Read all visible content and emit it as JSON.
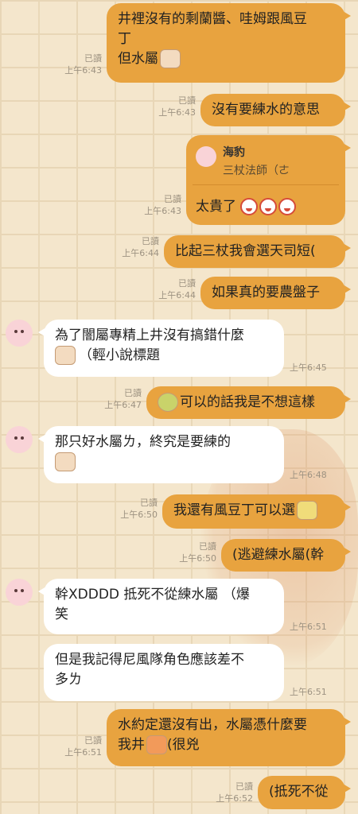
{
  "messages": [
    {
      "id": "m1",
      "text_line1": "井裡沒有的剩蘭醬、哇姆跟風豆",
      "text_line2": "丁",
      "text_line3": "但水屬",
      "read": "已讀",
      "time": "上午6:43"
    },
    {
      "id": "m2",
      "text": "沒有要練水的意思",
      "read": "已讀",
      "time": "上午6:43"
    },
    {
      "id": "m3",
      "reply_name": "海豹",
      "reply_text": "三杖法師（ㄜ",
      "text": "太貴了",
      "read": "已讀",
      "time": "上午6:43"
    },
    {
      "id": "m4",
      "text": "比起三杖我會選天司短(",
      "read": "已讀",
      "time": "上午6:44"
    },
    {
      "id": "m5",
      "text": "如果真的要農盤子",
      "read": "已讀",
      "time": "上午6:44"
    },
    {
      "id": "m6",
      "text_line1": "為了闇屬專精上井沒有搞錯什麼",
      "text_line2": "（輕小說標題",
      "time": "上午6:45"
    },
    {
      "id": "m7",
      "text": "可以的話我是不想這樣",
      "read": "已讀",
      "time": "上午6:47"
    },
    {
      "id": "m8",
      "text_line1": "那只好水屬ㄌ，終究是要練的",
      "time": "上午6:48"
    },
    {
      "id": "m9",
      "text": "我還有風豆丁可以選",
      "read": "已讀",
      "time": "上午6:50"
    },
    {
      "id": "m10",
      "text": "(逃避練水屬(幹",
      "read": "已讀",
      "time": "上午6:50"
    },
    {
      "id": "m11",
      "text_line1": "幹XDDDD 抵死不從練水屬 （爆",
      "text_line2": "笑",
      "time": "上午6:51"
    },
    {
      "id": "m12",
      "text_line1": "但是我記得尼風隊角色應該差不",
      "text_line2": "多ㄌ",
      "time": "上午6:51"
    },
    {
      "id": "m13",
      "text_line1": "水約定還沒有出，水屬憑什麼要",
      "text_line2": "我井",
      "text_line2b": "(很兇",
      "read": "已讀",
      "time": "上午6:51"
    },
    {
      "id": "m14",
      "text": "(抵死不從",
      "read": "已讀",
      "time": "上午6:52"
    }
  ],
  "colors": {
    "outgoing": "#e8a33f",
    "incoming": "#ffffff",
    "background": "#f4e6cc"
  }
}
